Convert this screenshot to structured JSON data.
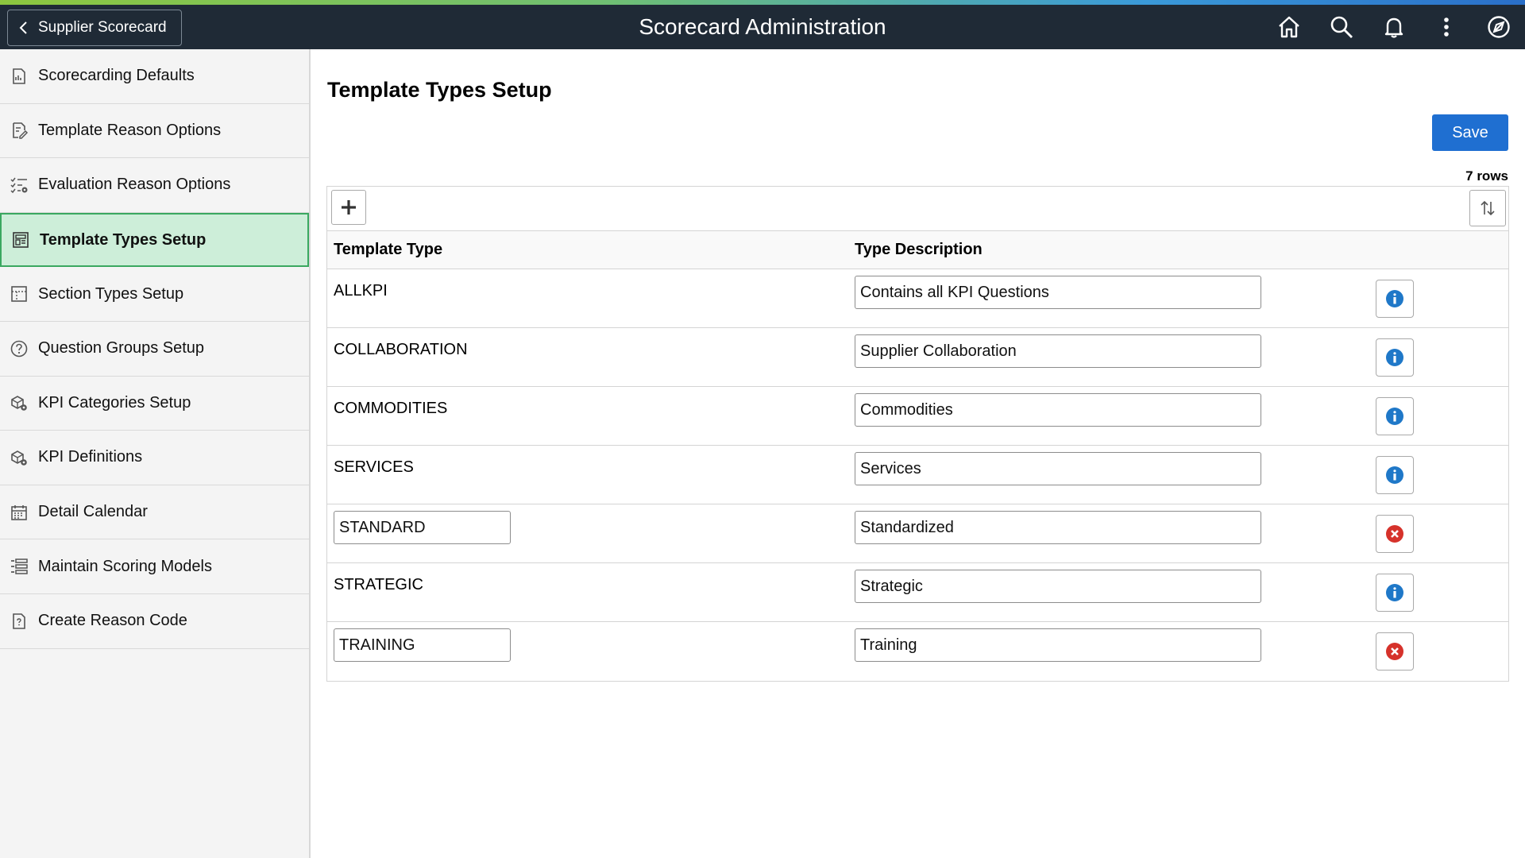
{
  "header": {
    "back_label": "Supplier Scorecard",
    "title": "Scorecard Administration",
    "icons": [
      "home-icon",
      "search-icon",
      "notifications-icon",
      "more-actions-icon",
      "navigator-icon"
    ]
  },
  "sidebar": {
    "items": [
      {
        "label": "Scorecarding Defaults",
        "icon": "report-icon"
      },
      {
        "label": "Template Reason Options",
        "icon": "document-edit-icon"
      },
      {
        "label": "Evaluation Reason Options",
        "icon": "checklist-settings-icon"
      },
      {
        "label": "Template Types Setup",
        "icon": "template-icon",
        "active": true
      },
      {
        "label": "Section Types Setup",
        "icon": "section-grid-icon"
      },
      {
        "label": "Question Groups Setup",
        "icon": "question-icon"
      },
      {
        "label": "KPI Categories Setup",
        "icon": "kpi-settings-icon"
      },
      {
        "label": "KPI Definitions",
        "icon": "kpi-settings-icon"
      },
      {
        "label": "Detail Calendar",
        "icon": "calendar-icon"
      },
      {
        "label": "Maintain Scoring Models",
        "icon": "list-icon"
      },
      {
        "label": "Create Reason Code",
        "icon": "document-question-icon"
      }
    ]
  },
  "main": {
    "page_title": "Template Types Setup",
    "save_label": "Save",
    "row_count": "7 rows",
    "columns": {
      "type": "Template Type",
      "desc": "Type Description"
    },
    "rows": [
      {
        "type": "ALLKPI",
        "editable_type": false,
        "desc": "Contains all KPI Questions",
        "action": "info"
      },
      {
        "type": "COLLABORATION",
        "editable_type": false,
        "desc": "Supplier Collaboration",
        "action": "info"
      },
      {
        "type": "COMMODITIES",
        "editable_type": false,
        "desc": "Commodities",
        "action": "info"
      },
      {
        "type": "SERVICES",
        "editable_type": false,
        "desc": "Services",
        "action": "info"
      },
      {
        "type": "STANDARD",
        "editable_type": true,
        "desc": "Standardized",
        "action": "delete"
      },
      {
        "type": "STRATEGIC",
        "editable_type": false,
        "desc": "Strategic",
        "action": "info"
      },
      {
        "type": "TRAINING",
        "editable_type": true,
        "desc": "Training",
        "action": "delete"
      }
    ]
  },
  "colors": {
    "header_bg": "#1f2a36",
    "accent_green": "#3aa860",
    "active_bg": "#cdeed9",
    "save_blue": "#1f6fd1",
    "info_blue": "#1f78c8",
    "delete_red": "#d6322b"
  }
}
